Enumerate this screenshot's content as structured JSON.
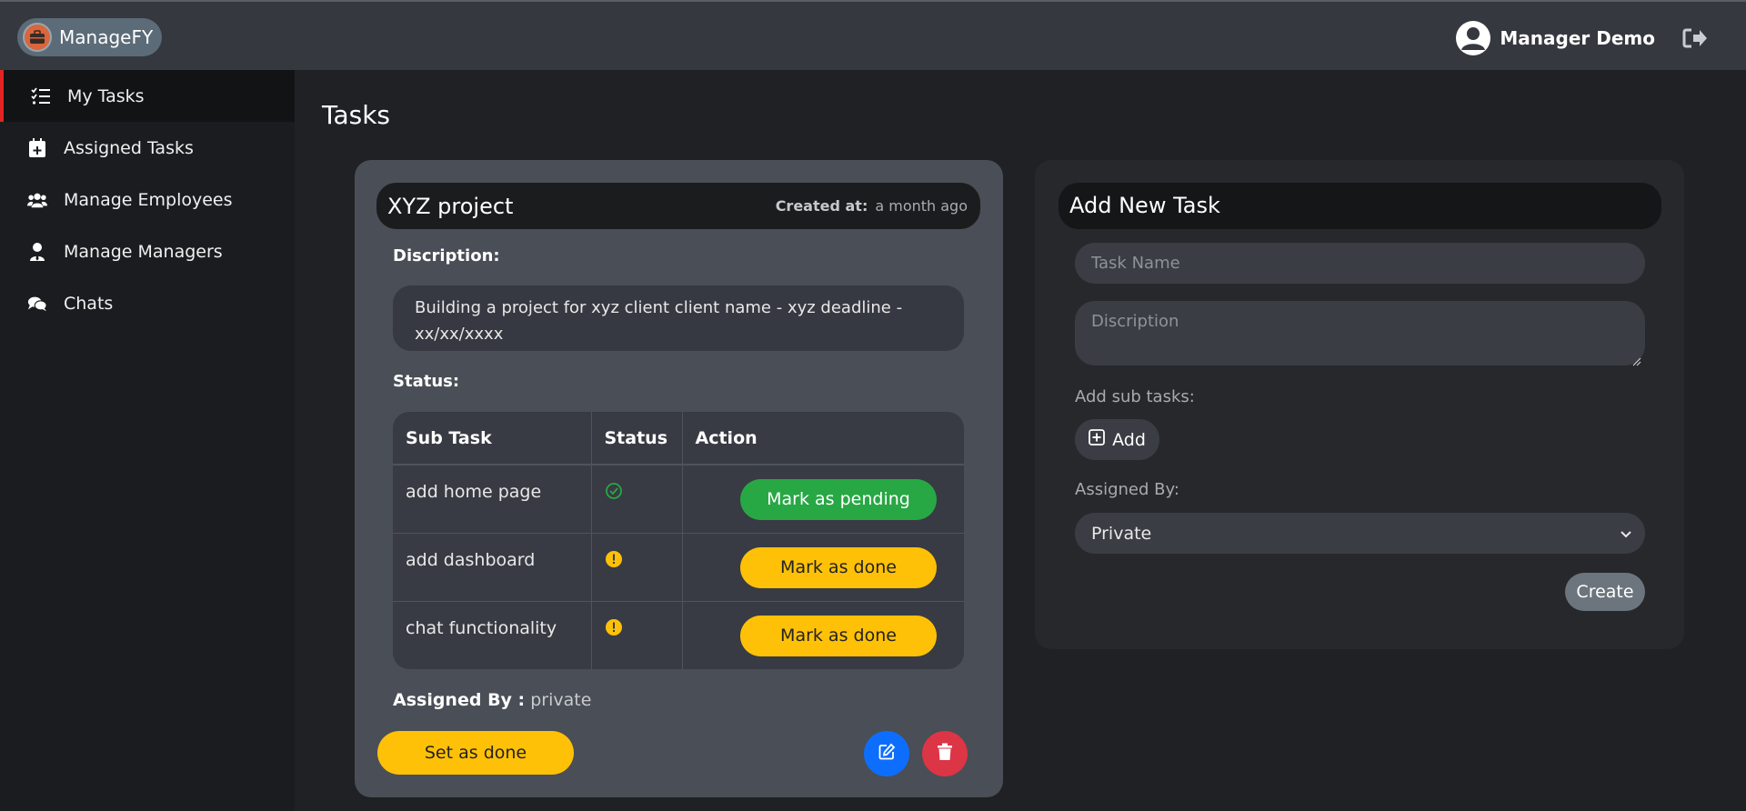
{
  "app": {
    "brand": "ManageFY"
  },
  "header": {
    "user_name": "Manager Demo"
  },
  "sidebar": {
    "items": [
      {
        "label": "My Tasks",
        "icon": "tasks-icon",
        "active": true
      },
      {
        "label": "Assigned Tasks",
        "icon": "calendar-plus-icon",
        "active": false
      },
      {
        "label": "Manage Employees",
        "icon": "users-icon",
        "active": false
      },
      {
        "label": "Manage Managers",
        "icon": "user-tie-icon",
        "active": false
      },
      {
        "label": "Chats",
        "icon": "comments-icon",
        "active": false
      }
    ]
  },
  "main": {
    "title": "Tasks"
  },
  "task": {
    "title": "XYZ project",
    "created_label": "Created at:",
    "created_value": "a month ago",
    "description_label": "Discription:",
    "description": "Building a project for xyz client client name - xyz deadline - xx/xx/xxxx",
    "status_label": "Status:",
    "table_headers": [
      "Sub Task",
      "Status",
      "Action"
    ],
    "subtasks": [
      {
        "name": "add home page",
        "status": "done",
        "status_icon": "check-circle-icon",
        "action": "Mark as pending",
        "color": "#28a745"
      },
      {
        "name": "add dashboard",
        "status": "pending",
        "status_icon": "exclamation-circle-icon",
        "action": "Mark as done",
        "color": "#ffc107"
      },
      {
        "name": "chat functionality",
        "status": "pending",
        "status_icon": "exclamation-circle-icon",
        "action": "Mark as done",
        "color": "#ffc107"
      }
    ],
    "assigned_by_label": "Assigned By :",
    "assigned_by_value": "private",
    "set_done_label": "Set as done"
  },
  "add_task": {
    "title": "Add New Task",
    "task_name_placeholder": "Task Name",
    "description_placeholder": "Discription",
    "subtasks_label": "Add sub tasks:",
    "add_label": "Add",
    "assigned_by_label": "Assigned By:",
    "assigned_by_selected": "Private",
    "create_label": "Create"
  },
  "colors": {
    "accent_red": "#e02424",
    "success": "#28a745",
    "warning": "#ffc107",
    "primary": "#0d6efd",
    "danger": "#dc3545"
  }
}
